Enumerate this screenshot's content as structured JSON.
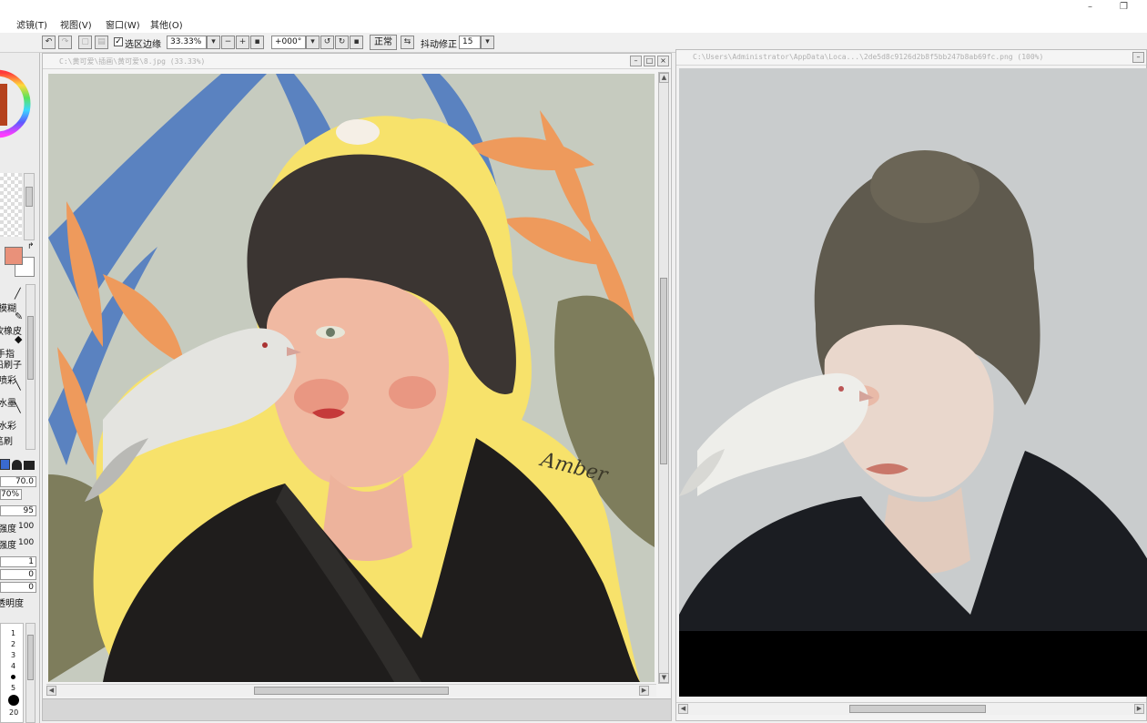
{
  "menu": {
    "items": [
      "滤镜(T)",
      "视图(V)",
      "窗口(W)",
      "其他(O)"
    ],
    "minimize": "–",
    "restore": "❐"
  },
  "toolbar": {
    "selection_edge_label": "选区边缘",
    "zoom_value": "33.33%",
    "rotation_value": "+000°",
    "blend_mode": "正常",
    "stabilizer_label": "抖动修正",
    "stabilizer_value": "15"
  },
  "left_panel": {
    "tool_labels": [
      "模糊",
      "软橡皮",
      "手指",
      "铅刷子",
      "喷彩",
      "水墨",
      "水彩",
      "笔刷"
    ],
    "brush_size": "70.0",
    "brush_density": "70%",
    "param_value": "95",
    "strength_label_1": "强度",
    "strength_value_1": "100",
    "strength_label_2": "强度",
    "strength_value_2": "100",
    "value_1": "1",
    "value_2": "0",
    "value_3": "0",
    "opacity_label": "透明度",
    "size_ticks": [
      "1",
      "2",
      "3",
      "4",
      "5",
      "20"
    ],
    "main_color": "#e9917a"
  },
  "doc_left": {
    "title": "C:\\黄可爱\\插画\\黄可爱\\8.jpg (33.33%)",
    "signature": "Amber"
  },
  "doc_right": {
    "title": "C:\\Users\\Administrator\\AppData\\Loca...\\2de5d8c9126d2b8f5bb247b8ab69fc.png (100%)"
  }
}
